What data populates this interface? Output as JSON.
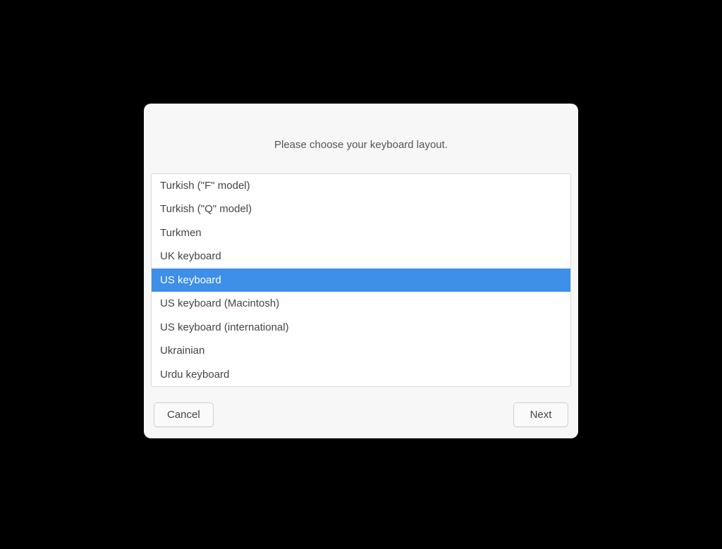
{
  "dialog": {
    "title": "Please choose your keyboard layout.",
    "items": [
      {
        "label": "Turkish (\"F\" model)",
        "selected": false
      },
      {
        "label": "Turkish (\"Q\" model)",
        "selected": false
      },
      {
        "label": "Turkmen",
        "selected": false
      },
      {
        "label": "UK keyboard",
        "selected": false
      },
      {
        "label": "US keyboard",
        "selected": true
      },
      {
        "label": "US keyboard (Macintosh)",
        "selected": false
      },
      {
        "label": "US keyboard (international)",
        "selected": false
      },
      {
        "label": "Ukrainian",
        "selected": false
      },
      {
        "label": "Urdu keyboard",
        "selected": false
      }
    ],
    "buttons": {
      "cancel": "Cancel",
      "next": "Next"
    }
  }
}
